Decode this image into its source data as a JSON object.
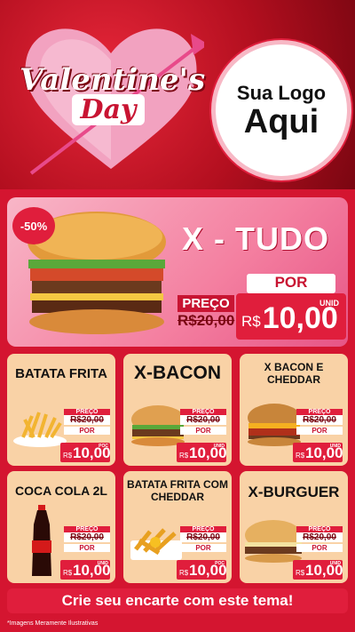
{
  "header": {
    "valentines_line1": "Valentine's",
    "valentines_line2": "Day",
    "logo_line1": "Sua Logo",
    "logo_line2": "Aqui"
  },
  "feature": {
    "discount": "-50%",
    "name": "X - TUDO",
    "por_label": "POR",
    "preco_label": "PREÇO",
    "old_price": "R$20,00",
    "currency": "R$",
    "price": "10,00",
    "unit": "UNID"
  },
  "cards": [
    {
      "name": "BATATA FRITA",
      "preco_label": "PREÇO",
      "old_price": "R$20,00",
      "por_label": "POR",
      "currency": "R$",
      "price": "10,00",
      "unit": "POC"
    },
    {
      "name": "X-BACON",
      "preco_label": "PREÇO",
      "old_price": "R$20,00",
      "por_label": "POR",
      "currency": "R$",
      "price": "10,00",
      "unit": "UNID"
    },
    {
      "name": "X BACON E CHEDDAR",
      "preco_label": "PREÇO",
      "old_price": "R$20,00",
      "por_label": "POR",
      "currency": "R$",
      "price": "10,00",
      "unit": "UNID"
    },
    {
      "name": "COCA COLA 2L",
      "preco_label": "PREÇO",
      "old_price": "R$20,00",
      "por_label": "POR",
      "currency": "R$",
      "price": "10,00",
      "unit": "UNID"
    },
    {
      "name": "BATATA FRITA COM CHEDDAR",
      "preco_label": "PREÇO",
      "old_price": "R$20,00",
      "por_label": "POR",
      "currency": "R$",
      "price": "10,00",
      "unit": "POC"
    },
    {
      "name": "X-BURGUER",
      "preco_label": "PREÇO",
      "old_price": "R$20,00",
      "por_label": "POR",
      "currency": "R$",
      "price": "10,00",
      "unit": "UNID"
    }
  ],
  "banner": "Crie seu encarte com este tema!",
  "footnote": "*Imagens Meramente Ilustrativas",
  "colors": {
    "primary": "#e01e3c",
    "background": "#d41530",
    "card": "#f9d2a6",
    "pink": "#f47fa0"
  }
}
